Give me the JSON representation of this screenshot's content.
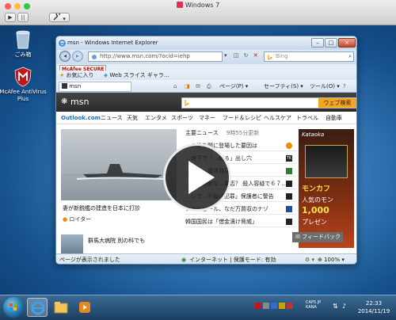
{
  "vm": {
    "title": "Windows 7",
    "play_icon": "▶",
    "pause_icon": "||",
    "settings_icon": "wrench"
  },
  "desktop": {
    "recycle_bin_label": "ごみ箱",
    "mcafee_label": "McAfee AntiVirus Plus"
  },
  "ie": {
    "window_title": "msn - Windows Internet Explorer",
    "address_url": "http://www.msn.com/?ocid=iehp",
    "search_placeholder": "Bing",
    "mcafee_toolbar": "McAfee SECURE",
    "favorites_label": "お気に入り",
    "web_slice_label": "Web スライス ギャラ...",
    "tab_label": "msn",
    "cmd_page": "ページ(P)",
    "cmd_safety": "セーフティ(S)",
    "cmd_tools": "ツール(O)",
    "status_text": "ページが表示されました",
    "zone_text": "インターネット | 保護モード: 有効",
    "zoom_text": "100%"
  },
  "msn": {
    "logo": "msn",
    "search_button": "ウェブ検索",
    "categories": [
      "Outlook.com",
      "ニュース",
      "天気",
      "エンタメ",
      "スポーツ",
      "マネー",
      "フード＆レシピ",
      "ヘルスケア",
      "トラベル",
      "自動車"
    ],
    "top_story_label": "主要ニュース",
    "updated_text": "9時55分更新",
    "headlines": [
      "…の党を開に登場した要因は",
      "…地下で「…掘る」出し穴",
      "…フク…遺体発見",
      "…ルが過剰な…量否？ 殺人容疑で６７…",
      "…いで…不倫は犯罪」保護者に警告",
      "アサヒビール、なだ万買収のナゾ",
      "韓国国民は「借金漬け脅威」"
    ],
    "main_caption": "妻が新鋭艦の建造を日本に打診",
    "source": "ロイター",
    "sub_story": "群馬大病院 別の科でも",
    "feedback_button": "フィードバック",
    "ad_brand": "Kataoka",
    "ad_text1": "モンカフ",
    "ad_text2": "人気のモン",
    "ad_text3": "1,000",
    "ad_text4": "プレゼン"
  },
  "tray": {
    "ime": "CAPS JP KANA",
    "time": "22:33",
    "date": "2014/11/19"
  }
}
